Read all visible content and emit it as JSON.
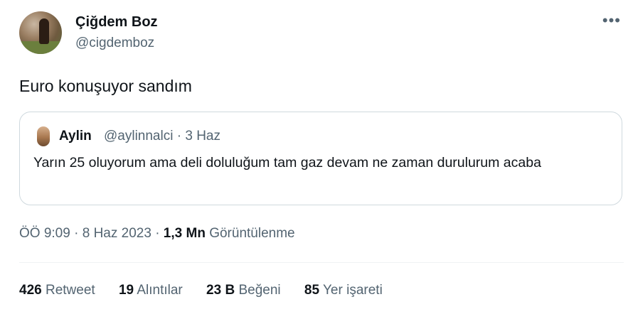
{
  "author": {
    "name": "Çiğdem Boz",
    "handle": "@cigdemboz"
  },
  "more_icon": "•••",
  "tweet_text": "Euro konuşuyor sandım",
  "quoted": {
    "name": "Aylin",
    "handle": "@aylinnalci",
    "separator": "·",
    "date": "3 Haz",
    "text": "Yarın 25 oluyorum ama deli doluluğum tam gaz devam ne zaman durulurum acaba"
  },
  "meta": {
    "time": "ÖÖ 9:09",
    "sep1": "·",
    "date": "8 Haz 2023",
    "sep2": "·",
    "views_count": "1,3 Mn",
    "views_label": "Görüntülenme"
  },
  "stats": [
    {
      "count": "426",
      "label": "Retweet"
    },
    {
      "count": "19",
      "label": "Alıntılar"
    },
    {
      "count": "23 B",
      "label": "Beğeni"
    },
    {
      "count": "85",
      "label": "Yer işareti"
    }
  ]
}
